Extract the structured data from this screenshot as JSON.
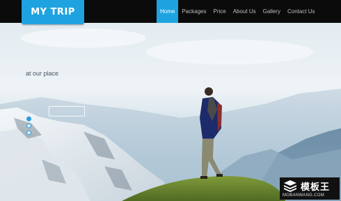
{
  "logo": {
    "text": "MY TRIP"
  },
  "nav": {
    "items": [
      {
        "label": "Home",
        "active": true
      },
      {
        "label": "Packages",
        "active": false
      },
      {
        "label": "Price",
        "active": false
      },
      {
        "label": "About Us",
        "active": false
      },
      {
        "label": "Gallery",
        "active": false
      },
      {
        "label": "Contact Us",
        "active": false
      }
    ]
  },
  "hero": {
    "tagline": "at our place",
    "slider": {
      "count": 3,
      "active_index": 0
    }
  },
  "watermark": {
    "title": "模板王",
    "subtitle": "MOBANWANG.COM",
    "icon": "grid-logo-icon"
  },
  "colors": {
    "accent": "#1ea3e0",
    "nav_bg": "#0b0b0b"
  }
}
